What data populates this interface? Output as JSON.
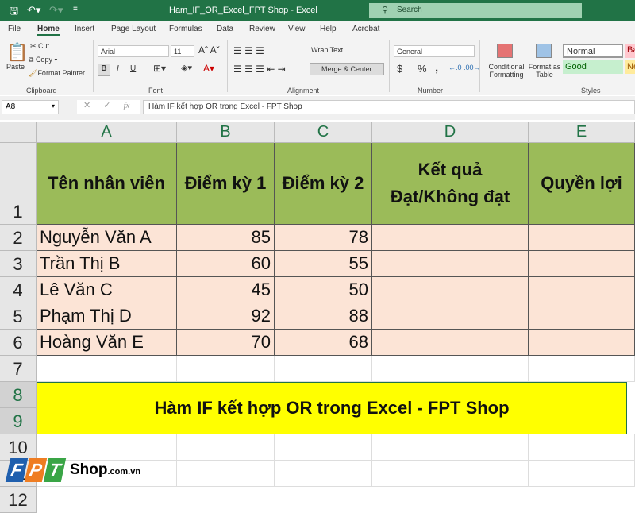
{
  "title_bar": {
    "title": "Ham_IF_OR_Excel_FPT Shop  -  Excel",
    "search_placeholder": "Search"
  },
  "tabs": [
    "File",
    "Home",
    "Insert",
    "Page Layout",
    "Formulas",
    "Data",
    "Review",
    "View",
    "Help",
    "Acrobat"
  ],
  "ribbon": {
    "clipboard": {
      "paste": "Paste",
      "cut": "Cut",
      "copy": "Copy",
      "format_painter": "Format Painter",
      "label": "Clipboard"
    },
    "font": {
      "name": "Arial",
      "size": "11",
      "bold": "B",
      "italic": "I",
      "underline": "U",
      "label": "Font"
    },
    "alignment": {
      "wrap_text": "Wrap Text",
      "merge_center": "Merge & Center",
      "label": "Alignment"
    },
    "number": {
      "format": "General",
      "currency": "$",
      "percent": "%",
      "comma": ",",
      "label": "Number"
    },
    "styles": {
      "conditional": "Conditional Formatting",
      "format_table": "Format as Table",
      "normal": "Normal",
      "bad": "Ba",
      "good": "Good",
      "neutral": "Ne",
      "label": "Styles"
    }
  },
  "formula_bar": {
    "name_box": "A8",
    "fx": "fx",
    "formula": "Hàm IF kết hợp OR trong Excel - FPT Shop"
  },
  "columns": [
    "A",
    "B",
    "C",
    "D",
    "E"
  ],
  "rows": [
    "1",
    "2",
    "3",
    "4",
    "5",
    "6",
    "7",
    "8",
    "9",
    "10",
    "11",
    "12"
  ],
  "header": {
    "a": "Tên nhân viên",
    "b": "Điểm kỳ 1",
    "c": "Điểm kỳ 2",
    "d": "Kết quả Đạt/Không đạt",
    "e": "Quyền lợi"
  },
  "data": [
    {
      "name": "Nguyễn Văn A",
      "k1": "85",
      "k2": "78"
    },
    {
      "name": "Trần Thị B",
      "k1": "60",
      "k2": "55"
    },
    {
      "name": "Lê Văn C",
      "k1": "45",
      "k2": "50"
    },
    {
      "name": "Phạm Thị D",
      "k1": "92",
      "k2": "88"
    },
    {
      "name": "Hoàng Văn E",
      "k1": "70",
      "k2": "68"
    }
  ],
  "banner": "Hàm IF kết hợp OR trong Excel - FPT Shop",
  "logo": {
    "letters": [
      "F",
      "P",
      "T"
    ],
    "shop": "Shop",
    ".com.vn": ".com.vn"
  },
  "colors": {
    "excel_green": "#217346",
    "header_fill": "#9bbb59",
    "row_fill": "#fce4d6",
    "banner_fill": "#ffff00"
  }
}
